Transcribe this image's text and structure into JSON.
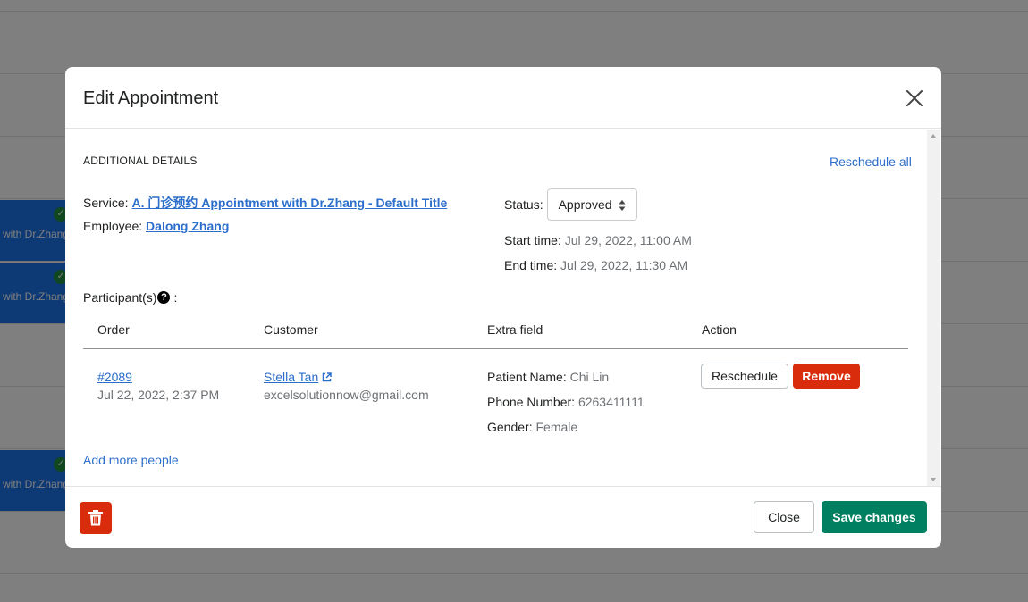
{
  "background": {
    "event_label": "with Dr.Zhang"
  },
  "modal": {
    "title": "Edit Appointment",
    "section_title": "ADDITIONAL DETAILS",
    "reschedule_all": "Reschedule all",
    "service_label": "Service:",
    "service_value": "A. 门诊预约 Appointment with Dr.Zhang - Default Title",
    "employee_label": "Employee:",
    "employee_value": "Dalong Zhang",
    "status_label": "Status:",
    "status_value": "Approved",
    "start_label": "Start time:",
    "start_value": "Jul 29, 2022, 11:00 AM",
    "end_label": "End time:",
    "end_value": "Jul 29, 2022, 11:30 AM",
    "participants_label": "Participant(s)",
    "participants_colon": ":",
    "table": {
      "headers": [
        "Order",
        "Customer",
        "Extra field",
        "Action"
      ],
      "rows": [
        {
          "order_id": "#2089",
          "order_date": "Jul 22, 2022, 2:37 PM",
          "customer_name": "Stella Tan",
          "customer_email": "excelsolutionnow@gmail.com",
          "extra": [
            {
              "label": "Patient Name:",
              "value": "Chi Lin"
            },
            {
              "label": "Phone Number:",
              "value": "6263411111"
            },
            {
              "label": "Gender:",
              "value": "Female"
            }
          ],
          "reschedule_label": "Reschedule",
          "remove_label": "Remove"
        }
      ]
    },
    "add_more": "Add more people",
    "close_label": "Close",
    "save_label": "Save changes"
  },
  "colors": {
    "link": "#2c6ecb",
    "danger": "#d82c0d",
    "primary": "#008060"
  },
  "icons": [
    "close-icon",
    "chevron-updown-icon",
    "help-icon",
    "external-link-icon",
    "trash-icon",
    "check-icon"
  ]
}
